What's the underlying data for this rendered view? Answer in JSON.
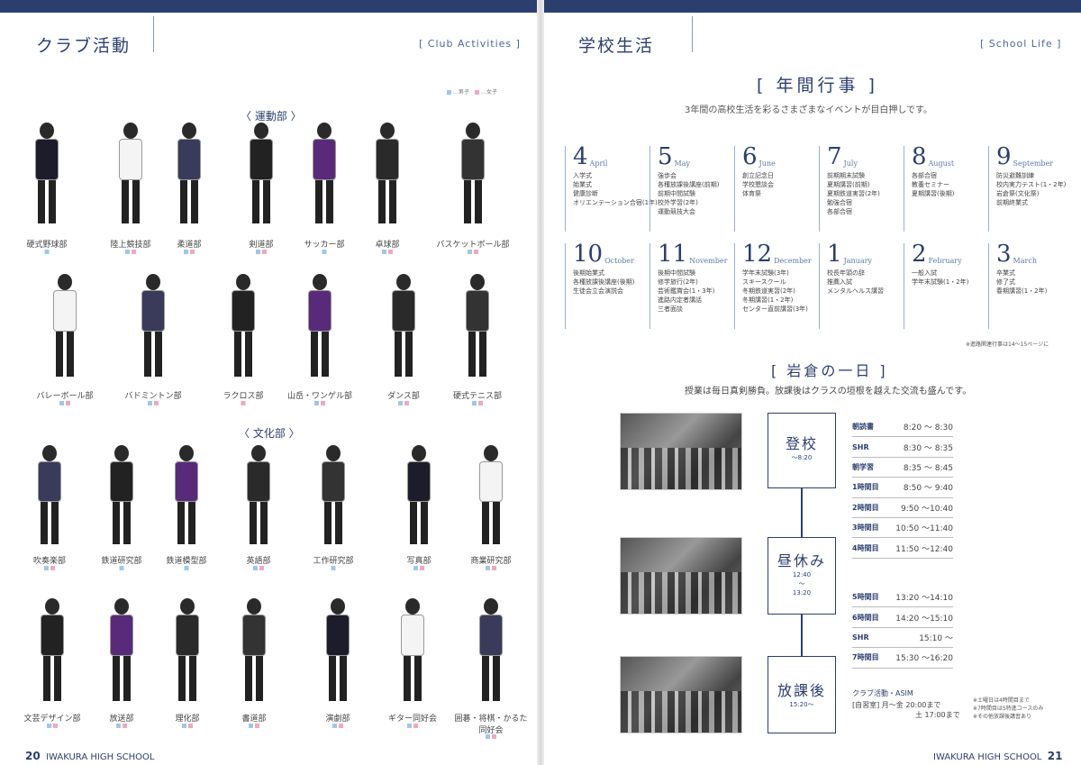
{
  "left": {
    "title": "クラブ活動",
    "title_en": "[ Club Activities ]",
    "legend": {
      "male": "…男子",
      "female": "…女子"
    },
    "sports_heading": "〈 運動部 〉",
    "culture_heading": "〈 文化部 〉",
    "sports_row1": [
      {
        "name": "硬式野球部",
        "sq": [
          "blue"
        ]
      },
      {
        "name": "陸上競技部",
        "sq": [
          "blue",
          "pink"
        ]
      },
      {
        "name": "柔道部",
        "sq": [
          "blue",
          "pink"
        ]
      },
      {
        "name": "剣道部",
        "sq": [
          "blue",
          "pink"
        ]
      },
      {
        "name": "サッカー部",
        "sq": [
          "blue"
        ]
      },
      {
        "name": "卓球部",
        "sq": [
          "blue",
          "pink"
        ]
      },
      {
        "name": "バスケットボール部",
        "sq": [
          "blue",
          "pink"
        ]
      }
    ],
    "sports_row2": [
      {
        "name": "バレーボール部",
        "sq": [
          "blue",
          "pink"
        ]
      },
      {
        "name": "バドミントン部",
        "sq": [
          "blue",
          "pink"
        ]
      },
      {
        "name": "ラクロス部",
        "sq": [
          "pink"
        ]
      },
      {
        "name": "山岳・ワンゲル部",
        "sq": [
          "blue",
          "pink"
        ]
      },
      {
        "name": "ダンス部",
        "sq": [
          "blue",
          "pink"
        ]
      },
      {
        "name": "硬式テニス部",
        "sq": [
          "blue",
          "pink"
        ]
      }
    ],
    "culture_row1": [
      {
        "name": "吹奏楽部",
        "sq": [
          "blue",
          "pink"
        ]
      },
      {
        "name": "鉄道研究部",
        "sq": [
          "blue"
        ]
      },
      {
        "name": "鉄道模型部",
        "sq": [
          "blue"
        ]
      },
      {
        "name": "英語部",
        "sq": [
          "blue",
          "pink"
        ]
      },
      {
        "name": "工作研究部",
        "sq": [
          "blue"
        ]
      },
      {
        "name": "写真部",
        "sq": [
          "blue",
          "pink"
        ]
      },
      {
        "name": "商業研究部",
        "sq": [
          "blue",
          "pink"
        ]
      }
    ],
    "culture_row2": [
      {
        "name": "文芸デザイン部",
        "sq": [
          "blue",
          "pink"
        ]
      },
      {
        "name": "放送部",
        "sq": [
          "blue",
          "pink"
        ]
      },
      {
        "name": "理化部",
        "sq": [
          "blue",
          "pink"
        ]
      },
      {
        "name": "書道部",
        "sq": [
          "blue",
          "pink"
        ]
      },
      {
        "name": "演劇部",
        "sq": [
          "blue",
          "pink"
        ]
      },
      {
        "name": "ギター同好会",
        "sq": [
          "blue",
          "pink"
        ]
      },
      {
        "name": "囲碁・将棋・かるた\n同好会",
        "sq": [
          "blue",
          "pink"
        ]
      }
    ],
    "page_num": "20",
    "school": "IWAKURA HIGH SCHOOL"
  },
  "right": {
    "title": "学校生活",
    "title_en": "[ School Life ]",
    "annual_title": "[ 年間行事 ]",
    "annual_sub": "3年間の高校生活を彩るさまざまなイベントが目白押しです。",
    "months_row1": [
      {
        "num": "4",
        "en": "April",
        "items": [
          "入学式",
          "始業式",
          "健康診断",
          "オリエンテーション合宿(1年)"
        ]
      },
      {
        "num": "5",
        "en": "May",
        "items": [
          "強歩会",
          "各種放課後講座(前期)",
          "前期中間試験",
          "校外学習(2年)",
          "運動競技大会"
        ]
      },
      {
        "num": "6",
        "en": "June",
        "items": [
          "創立記念日",
          "学校懇談会",
          "体育祭"
        ]
      },
      {
        "num": "7",
        "en": "July",
        "items": [
          "前期期末試験",
          "夏期講習(前期)",
          "夏期鉄道実習(2年)",
          "勉強合宿",
          "各部合宿"
        ]
      },
      {
        "num": "8",
        "en": "August",
        "items": [
          "各部合宿",
          "教養セミナー",
          "夏期講習(後期)"
        ]
      },
      {
        "num": "9",
        "en": "September",
        "items": [
          "防災避難訓練",
          "校内実力テスト(1・2年)",
          "岩倉祭(文化祭)",
          "前期終業式"
        ]
      }
    ],
    "months_row2": [
      {
        "num": "10",
        "en": "October",
        "items": [
          "後期始業式",
          "各種放課後講座(後期)",
          "生徒会立会演説会"
        ]
      },
      {
        "num": "11",
        "en": "November",
        "items": [
          "後期中間試験",
          "修学旅行(2年)",
          "芸術鑑賞会(1・3年)",
          "進路内定者講話",
          "三者面談"
        ]
      },
      {
        "num": "12",
        "en": "December",
        "items": [
          "学年末試験(3年)",
          "スキースクール",
          "冬期鉄道実習(2年)",
          "冬期講習(1・2年)",
          "センター直前講習(3年)"
        ]
      },
      {
        "num": "1",
        "en": "January",
        "items": [
          "校長年頭の辞",
          "推薦入試",
          "メンタルヘルス講習"
        ]
      },
      {
        "num": "2",
        "en": "February",
        "items": [
          "一般入試",
          "学年末試験(1・2年)"
        ]
      },
      {
        "num": "3",
        "en": "March",
        "items": [
          "卒業式",
          "修了式",
          "春期講習(1・2年)"
        ]
      }
    ],
    "annual_note": "※進路関連行事は14〜15ページに",
    "day_title": "[ 岩倉の一日 ]",
    "day_sub": "授業は毎日真剣勝負。放課後はクラスの垣根を越えた交流も盛んです。",
    "timeline": {
      "arrive": {
        "label": "登校",
        "time": "〜8:20"
      },
      "lunch": {
        "label": "昼休み",
        "time1": "12:40",
        "tilde": "〜",
        "time2": "13:20"
      },
      "after": {
        "label": "放課後",
        "time": "15:20〜"
      }
    },
    "schedule_morning": [
      {
        "p": "朝読書",
        "t": "8:20 〜  8:30"
      },
      {
        "p": "SHR",
        "t": "8:30 〜  8:35"
      },
      {
        "p": "朝学習",
        "t": "8:35 〜  8:45"
      },
      {
        "p": "1時間目",
        "t": "8:50 〜  9:40"
      },
      {
        "p": "2時間目",
        "t": "9:50 〜10:40"
      },
      {
        "p": "3時間目",
        "t": "10:50 〜11:40"
      },
      {
        "p": "4時間目",
        "t": "11:50 〜12:40"
      }
    ],
    "schedule_afternoon": [
      {
        "p": "5時間目",
        "t": "13:20 〜14:10"
      },
      {
        "p": "6時間目",
        "t": "14:20 〜15:10"
      },
      {
        "p": "SHR",
        "t": "15:10 〜"
      },
      {
        "p": "7時間目",
        "t": "15:30 〜16:20"
      }
    ],
    "after_title": "クラブ活動・ASIM",
    "after_row1": "[自習室] 月〜金  20:00まで",
    "after_row2": "土  17:00まで",
    "notes": [
      "※土曜日は4時間目まで",
      "※7時間目はS特進コースのみ",
      "※その他放課後講習あり"
    ],
    "page_num": "21",
    "school": "IWAKURA HIGH SCHOOL"
  }
}
